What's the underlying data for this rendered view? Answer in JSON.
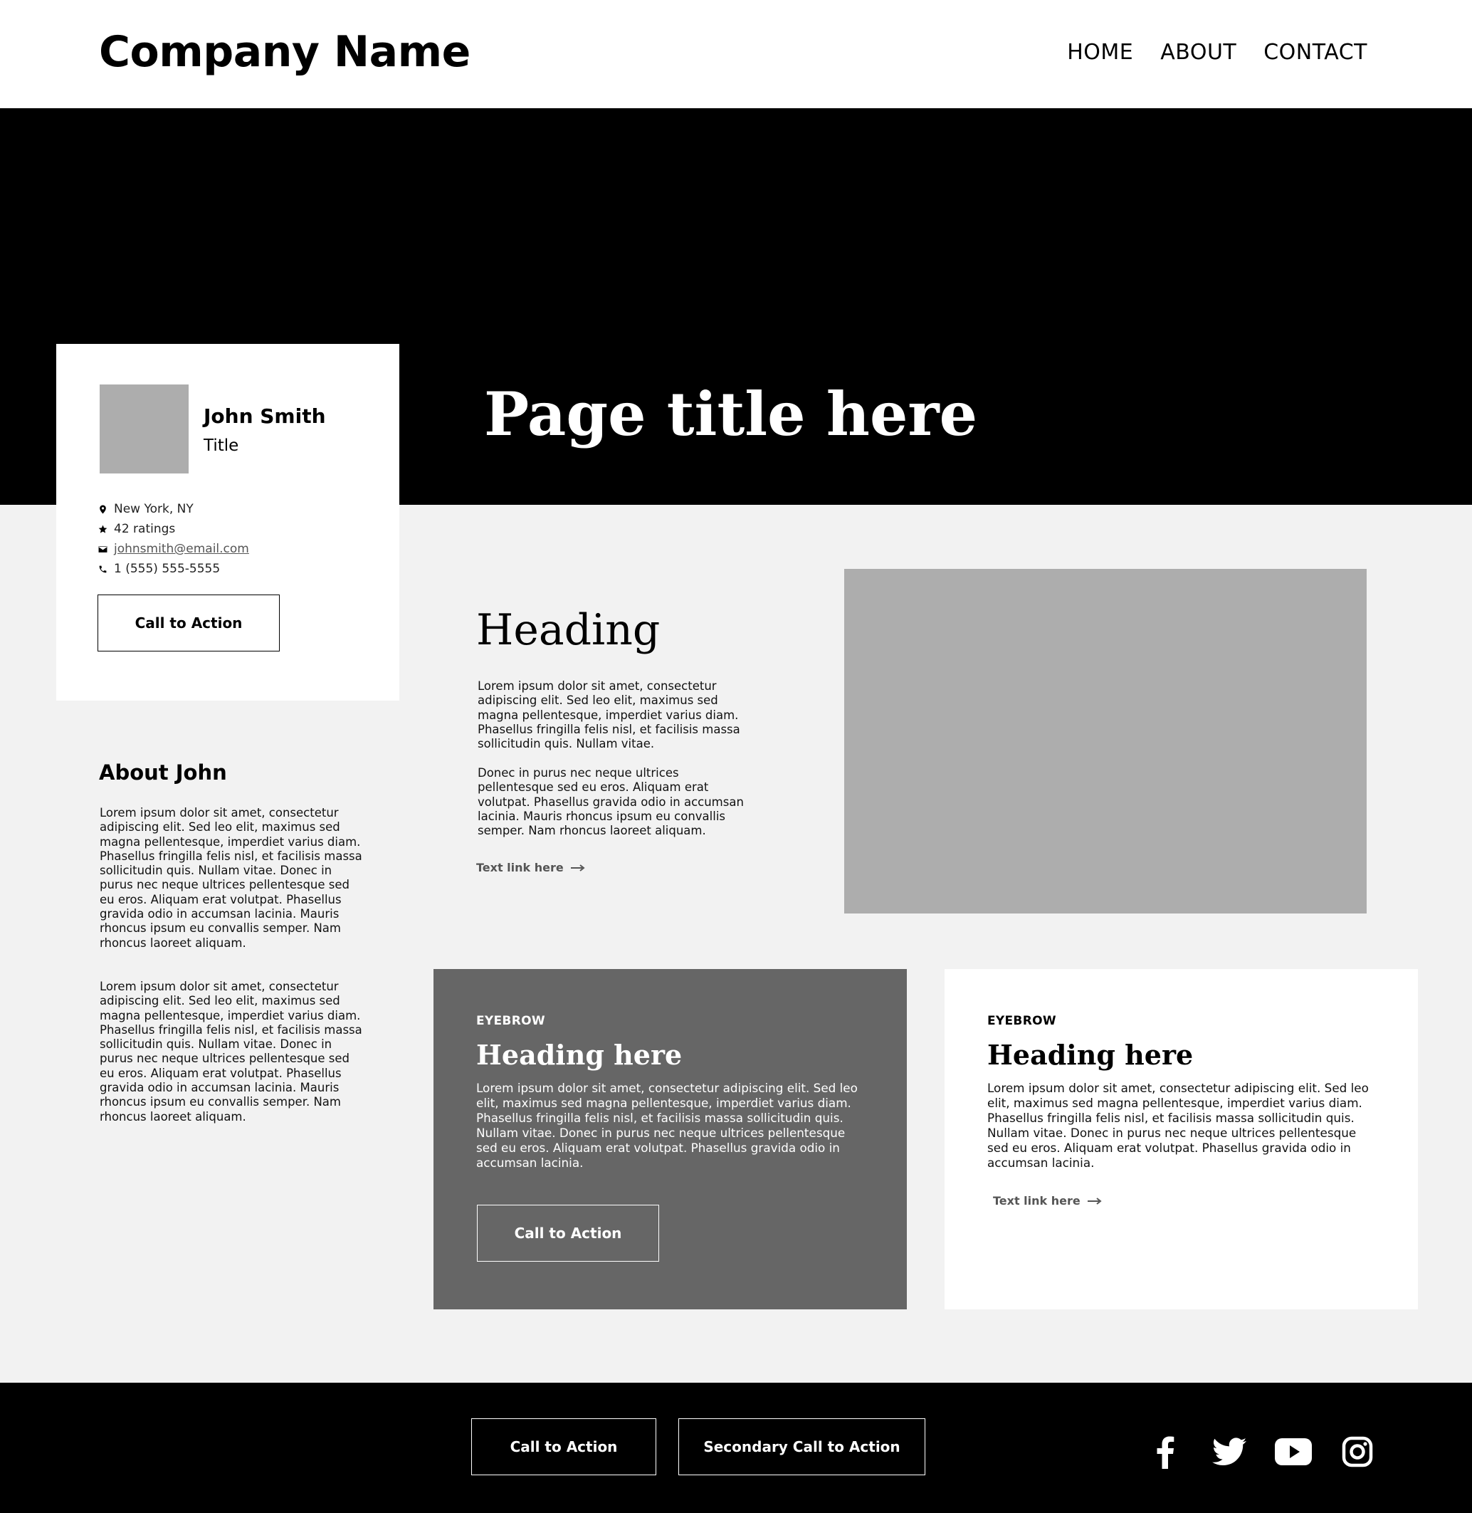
{
  "header": {
    "logo": "Company Name",
    "nav": [
      "HOME",
      "ABOUT",
      "CONTACT"
    ]
  },
  "hero": {
    "title": "Page title here"
  },
  "profile": {
    "name": "John Smith",
    "title": "Title",
    "location": "New York, NY",
    "ratings": "42 ratings",
    "email": "johnsmith@email.com",
    "phone": "1 (555) 555-5555",
    "cta": "Call to Action"
  },
  "about": {
    "heading": "About John",
    "paragraphs": [
      "Lorem ipsum dolor sit amet, consectetur adipiscing elit. Sed leo elit, maximus sed magna pellentesque, imperdiet varius diam. Phasellus fringilla felis nisl, et facilisis massa sollicitudin quis. Nullam vitae. Donec in purus nec neque ultrices pellentesque sed eu eros. Aliquam erat volutpat. Phasellus gravida odio in accumsan lacinia. Mauris rhoncus ipsum eu convallis semper. Nam rhoncus laoreet aliquam.",
      "Lorem ipsum dolor sit amet, consectetur adipiscing elit. Sed leo elit, maximus sed magna pellentesque, imperdiet varius diam. Phasellus fringilla felis nisl, et facilisis massa sollicitudin quis. Nullam vitae. Donec in purus nec neque ultrices pellentesque sed eu eros. Aliquam erat volutpat. Phasellus gravida odio in accumsan lacinia. Mauris rhoncus ipsum eu convallis semper. Nam rhoncus laoreet aliquam."
    ]
  },
  "main": {
    "heading": "Heading",
    "paragraphs": [
      "Lorem ipsum dolor sit amet, consectetur adipiscing elit. Sed leo elit, maximus sed magna pellentesque, imperdiet varius diam. Phasellus fringilla felis nisl, et facilisis massa sollicitudin quis. Nullam vitae.",
      "Donec in purus nec neque ultrices pellentesque sed eu eros. Aliquam erat volutpat. Phasellus gravida odio in accumsan lacinia. Mauris rhoncus ipsum eu convallis semper. Nam rhoncus laoreet aliquam."
    ],
    "link": "Text link here"
  },
  "cards": [
    {
      "eyebrow": "EYEBROW",
      "heading": "Heading here",
      "body": "Lorem ipsum dolor sit amet, consectetur adipiscing elit. Sed leo elit, maximus sed magna pellentesque, imperdiet varius diam. Phasellus fringilla felis nisl, et facilisis massa sollicitudin quis. Nullam vitae. Donec in purus nec neque ultrices pellentesque sed eu eros. Aliquam erat volutpat. Phasellus gravida odio in accumsan lacinia.",
      "cta": "Call to Action"
    },
    {
      "eyebrow": "EYEBROW",
      "heading": "Heading here",
      "body": "Lorem ipsum dolor sit amet, consectetur adipiscing elit. Sed leo elit, maximus sed magna pellentesque, imperdiet varius diam. Phasellus fringilla felis nisl, et facilisis massa sollicitudin quis. Nullam vitae. Donec in purus nec neque ultrices pellentesque sed eu eros. Aliquam erat volutpat. Phasellus gravida odio in accumsan lacinia.",
      "link": "Text link here"
    }
  ],
  "footer": {
    "cta_primary": "Call to Action",
    "cta_secondary": "Secondary Call to Action",
    "social": [
      "facebook-icon",
      "twitter-icon",
      "youtube-icon",
      "instagram-icon"
    ]
  },
  "colors": {
    "hero_bg": "#000000",
    "page_bg": "#f2f2f2",
    "placeholder": "#adadad",
    "card_dark": "#666666",
    "link": "#555555"
  }
}
